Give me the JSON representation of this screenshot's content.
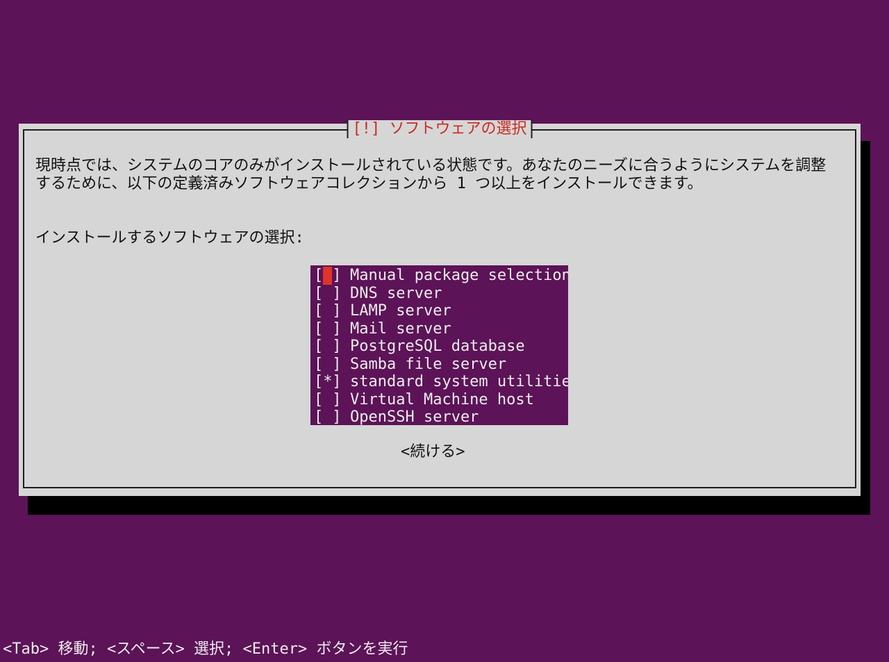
{
  "dialog": {
    "title": "[!] ソフトウェアの選択",
    "description": "現時点では、システムのコアのみがインストールされている状態です。あなたのニーズに合うようにシステムを調整するために、以下の定義済みソフトウェアコレクションから 1 つ以上をインストールできます。",
    "prompt": "インストールするソフトウェアの選択:",
    "items": [
      {
        "mark": " ",
        "label": "Manual package selection"
      },
      {
        "mark": " ",
        "label": "DNS server"
      },
      {
        "mark": " ",
        "label": "LAMP server"
      },
      {
        "mark": " ",
        "label": "Mail server"
      },
      {
        "mark": " ",
        "label": "PostgreSQL database"
      },
      {
        "mark": " ",
        "label": "Samba file server"
      },
      {
        "mark": "*",
        "label": "standard system utilities"
      },
      {
        "mark": " ",
        "label": "Virtual Machine host"
      },
      {
        "mark": " ",
        "label": "OpenSSH server"
      }
    ],
    "continue_label": "<続ける>"
  },
  "statusbar": {
    "text": "<Tab> 移動; <スペース> 選択; <Enter> ボタンを実行"
  },
  "colors": {
    "background": "#5c1357",
    "dialog": "#d6d6d6",
    "title": "#cc2a1e",
    "cursor": "#e0332a"
  }
}
